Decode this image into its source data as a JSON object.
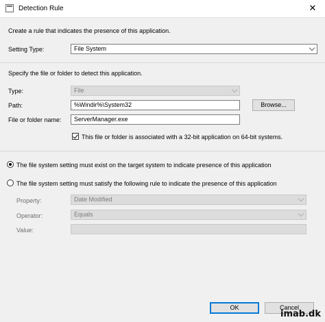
{
  "window": {
    "title": "Detection Rule",
    "close_glyph": "✕",
    "icon": "window-app-icon"
  },
  "intro": "Create a rule that indicates the presence of this application.",
  "setting_type": {
    "label": "Setting Type:",
    "value": "File System"
  },
  "specify": "Specify the file or folder to detect this application.",
  "type": {
    "label": "Type:",
    "value": "File"
  },
  "path": {
    "label": "Path:",
    "value": "%Windir%\\System32"
  },
  "browse_label": "Browse...",
  "file_or_folder": {
    "label": "File or folder name:",
    "value": "ServerManager.exe"
  },
  "bit32": {
    "label": "This file or folder is associated with a 32-bit application on 64-bit systems.",
    "checked": true
  },
  "radio_exist": {
    "label": "The file system setting must exist on the target system to indicate presence of this application",
    "selected": true
  },
  "radio_rule": {
    "label": "The file system setting must satisfy the following rule to indicate the presence of this application",
    "selected": false
  },
  "property": {
    "label": "Property:",
    "value": "Date Modified"
  },
  "operator": {
    "label": "Operator:",
    "value": "Equals"
  },
  "value": {
    "label": "Value:",
    "value": ""
  },
  "ok_label": "OK",
  "cancel_label": "Cancel",
  "watermark": "imab.dk"
}
